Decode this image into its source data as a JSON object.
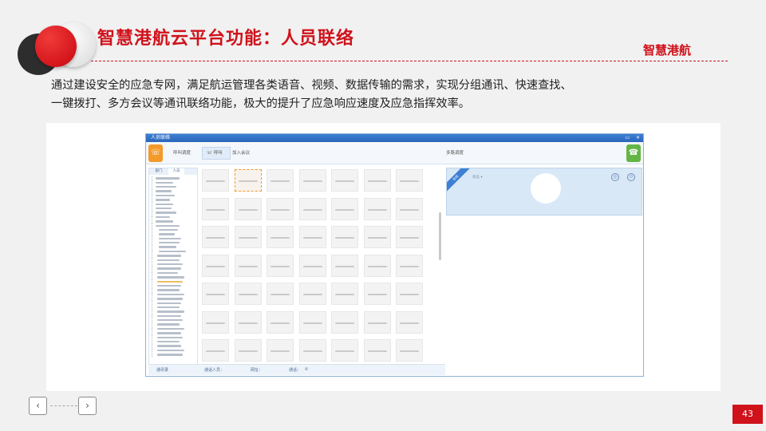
{
  "slide": {
    "title": "智慧港航云平台功能：人员联络",
    "brand": "智慧港航",
    "description_line1": "通过建设安全的应急专网，满足航运管理各类语音、视频、数据传输的需求，实现分组通讯、快速查找、",
    "description_line2": "一键拨打、多方会议等通讯联络功能，极大的提升了应急响应速度及应急指挥效率。",
    "page_number": "43",
    "prev_label": "‹",
    "next_label": "›"
  },
  "colors": {
    "accent_red": "#d0121b",
    "window_blue": "#3f7fd3",
    "call_orange": "#f39a2b",
    "hangup_green": "#63b646"
  },
  "app": {
    "window_title": "人员联络",
    "window_controls": [
      "▭",
      "✕"
    ],
    "toolbar": {
      "call_icon": "phone-icon",
      "item1": "呼叫调度",
      "item2": "☏ 呼叫",
      "item3": "加入会议",
      "item4": "多路调度",
      "hangup_icon": "hangup-icon"
    },
    "tree_tabs": [
      "部门",
      "人员"
    ],
    "right_panel": {
      "ribbon": "在线",
      "label": "状态 ▾",
      "icon1": "◎",
      "icon2": "⊙"
    },
    "status_bar": {
      "left": "通讯录",
      "mid": "通话人员：",
      "right": "网址：",
      "extra": "通话：",
      "phone_icon": "✆"
    }
  }
}
